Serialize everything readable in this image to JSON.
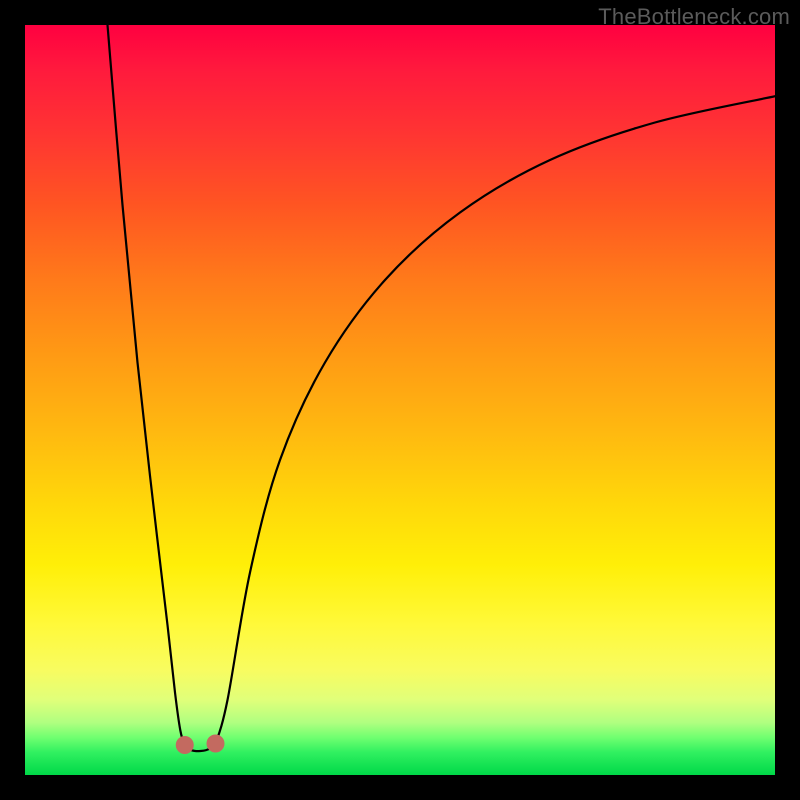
{
  "attribution": "TheBottleneck.com",
  "chart_data": {
    "type": "line",
    "title": "",
    "xlabel": "",
    "ylabel": "",
    "xlim": [
      0,
      100
    ],
    "ylim": [
      0,
      100
    ],
    "series": [
      {
        "name": "left-descending-branch",
        "x": [
          11,
          13,
          15,
          17,
          19,
          20,
          20.7,
          21.3
        ],
        "y": [
          100,
          76,
          55,
          37,
          20,
          11,
          6,
          4
        ]
      },
      {
        "name": "valley-floor",
        "x": [
          21.3,
          22.0,
          22.7,
          23.4,
          24.1,
          24.8,
          25.4
        ],
        "y": [
          4.0,
          3.4,
          3.2,
          3.2,
          3.3,
          3.6,
          4.2
        ]
      },
      {
        "name": "right-rising-branch",
        "x": [
          25.4,
          27,
          30,
          34,
          40,
          48,
          58,
          70,
          84,
          100
        ],
        "y": [
          4.2,
          10,
          27,
          42,
          55,
          66,
          75,
          82,
          87,
          90.5
        ]
      }
    ],
    "markers": [
      {
        "name": "valley-left-marker",
        "x": 21.3,
        "y": 4.0
      },
      {
        "name": "valley-right-marker",
        "x": 25.4,
        "y": 4.2
      }
    ],
    "marker_style": {
      "color": "#c36a60",
      "radius_px": 9
    },
    "background_gradient": {
      "type": "vertical",
      "stops": [
        {
          "pos": 0.0,
          "color": "#ff0040"
        },
        {
          "pos": 0.5,
          "color": "#ffc010"
        },
        {
          "pos": 0.8,
          "color": "#fff93a"
        },
        {
          "pos": 1.0,
          "color": "#00d848"
        }
      ]
    }
  }
}
